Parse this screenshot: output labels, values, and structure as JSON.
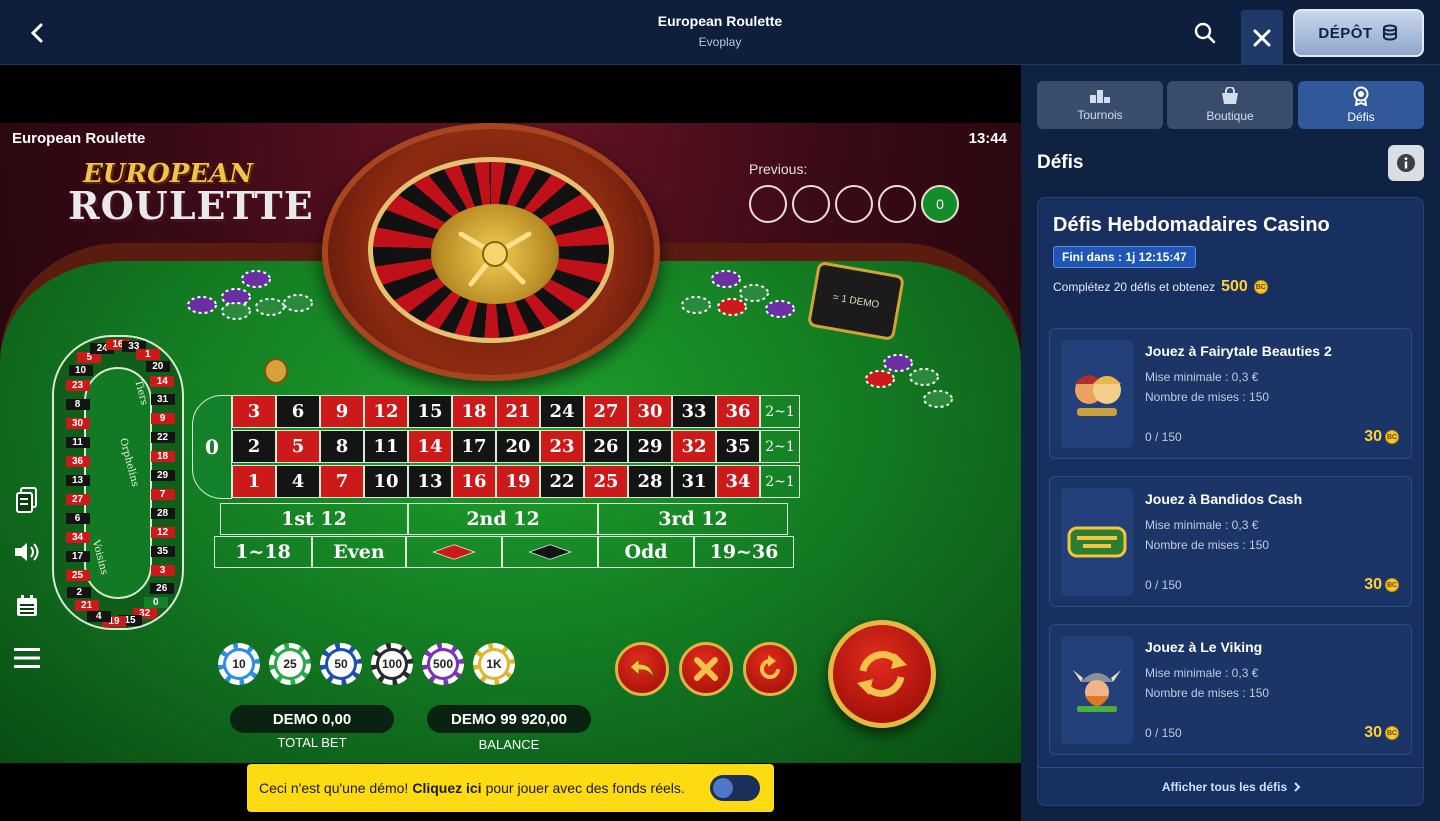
{
  "header": {
    "title": "European Roulette",
    "provider": "Evoplay",
    "deposit_label": "DÉPÔT"
  },
  "game": {
    "name_label": "European Roulette",
    "clock": "13:44",
    "logo_line1": "EUROPEAN",
    "logo_line2": "ROULETTE",
    "previous_label": "Previous:",
    "previous_results": [
      "",
      "",
      "",
      "",
      "0"
    ],
    "demo_chip_note": "= 1 DEMO",
    "grid_rows": [
      [
        "3",
        "6",
        "9",
        "12",
        "15",
        "18",
        "21",
        "24",
        "27",
        "30",
        "33",
        "36"
      ],
      [
        "2",
        "5",
        "8",
        "11",
        "14",
        "17",
        "20",
        "23",
        "26",
        "29",
        "32",
        "35"
      ],
      [
        "1",
        "4",
        "7",
        "10",
        "13",
        "16",
        "19",
        "22",
        "25",
        "28",
        "31",
        "34"
      ]
    ],
    "zero": "0",
    "column_bets": [
      "2~1",
      "2~1",
      "2~1"
    ],
    "dozens": [
      "1st 12",
      "2nd 12",
      "3rd 12"
    ],
    "outside_bets": [
      "1~18",
      "Even",
      "",
      "",
      "Odd",
      "19~36"
    ],
    "racetrack_numbers": [
      "23",
      "10",
      "5",
      "24",
      "16",
      "33",
      "1",
      "20",
      "14",
      "31",
      "9",
      "22",
      "18",
      "29",
      "7",
      "28",
      "12",
      "35",
      "3",
      "26",
      "0",
      "32",
      "15",
      "19",
      "4",
      "21",
      "2",
      "25",
      "17",
      "34",
      "6",
      "27",
      "13",
      "36",
      "11",
      "30",
      "8"
    ],
    "racetrack_labels": [
      "Tiers",
      "Orphelins",
      "Voisins"
    ],
    "chips": [
      "10",
      "25",
      "50",
      "100",
      "500",
      "1K"
    ],
    "total_bet_value": "DEMO 0,00",
    "total_bet_label": "TOTAL BET",
    "balance_value": "DEMO 99 920,00",
    "balance_label": "BALANCE"
  },
  "demo_banner": {
    "text_before": "Ceci n'est qu'une démo!",
    "link": "Cliquez ici",
    "text_after": "pour jouer avec des fonds réels."
  },
  "panel": {
    "tabs": [
      {
        "label": "Tournois",
        "icon": "podium-icon"
      },
      {
        "label": "Boutique",
        "icon": "shopping-bag-icon"
      },
      {
        "label": "Défis",
        "icon": "badge-icon"
      }
    ],
    "title": "Défis",
    "card": {
      "title": "Défis Hebdomadaires Casino",
      "countdown": "Fini dans : 1j 12:15:47",
      "description": "Complétez 20 défis et obtenez",
      "reward": "500",
      "tasks": [
        {
          "name": "Jouez à Fairytale Beauties 2",
          "min_bet": "Mise minimale : 0,3 €",
          "bet_count": "Nombre de mises : 150",
          "progress": "0 / 150",
          "reward": "30"
        },
        {
          "name": "Jouez à Bandidos Cash",
          "min_bet": "Mise minimale : 0,3 €",
          "bet_count": "Nombre de mises : 150",
          "progress": "0 / 150",
          "reward": "30"
        },
        {
          "name": "Jouez à Le Viking",
          "min_bet": "Mise minimale : 0,3 €",
          "bet_count": "Nombre de mises : 150",
          "progress": "0 / 150",
          "reward": "30"
        }
      ],
      "see_all": "Afficher tous les défis"
    }
  },
  "colors": {
    "red": "#cc1a1a",
    "black": "#141414",
    "felt": "#137a22",
    "gold": "#ffd23a",
    "banner": "#fddb13",
    "navy": "#0e1f3d"
  }
}
